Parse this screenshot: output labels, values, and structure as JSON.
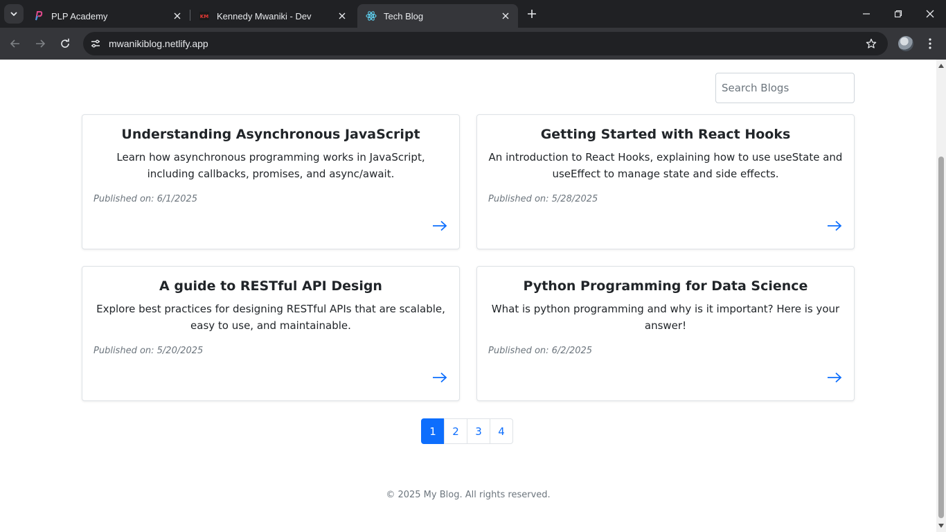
{
  "browser": {
    "tabs": [
      {
        "title": "PLP Academy",
        "icon": "plp-academy-favicon",
        "active": false
      },
      {
        "title": "Kennedy Mwaniki - Dev",
        "icon": "km-favicon",
        "active": false
      },
      {
        "title": "Tech Blog",
        "icon": "react-favicon",
        "active": true
      }
    ],
    "url": "mwanikiblog.netlify.app"
  },
  "search": {
    "placeholder": "Search Blogs",
    "value": ""
  },
  "posts": [
    {
      "title": "Understanding Asynchronous JavaScript",
      "description": "Learn how asynchronous programming works in JavaScript, including callbacks, promises, and async/await.",
      "date": "Published on: 6/1/2025"
    },
    {
      "title": "Getting Started with React Hooks",
      "description": "An introduction to React Hooks, explaining how to use useState and useEffect to manage state and side effects.",
      "date": "Published on: 5/28/2025"
    },
    {
      "title": "A guide to RESTful API Design",
      "description": "Explore best practices for designing RESTful APIs that are scalable, easy to use, and maintainable.",
      "date": "Published on: 5/20/2025"
    },
    {
      "title": "Python Programming for Data Science",
      "description": "What is python programming and why is it important? Here is your answer!",
      "date": "Published on: 6/2/2025"
    }
  ],
  "pagination": {
    "pages": [
      "1",
      "2",
      "3",
      "4"
    ],
    "current": "1"
  },
  "footer": {
    "text": "© 2025 My Blog. All rights reserved."
  },
  "colors": {
    "primary": "#0d6efd",
    "muted": "#6c757d",
    "text": "#212529",
    "chrome_dark": "#202124",
    "chrome_mid": "#35363a"
  }
}
